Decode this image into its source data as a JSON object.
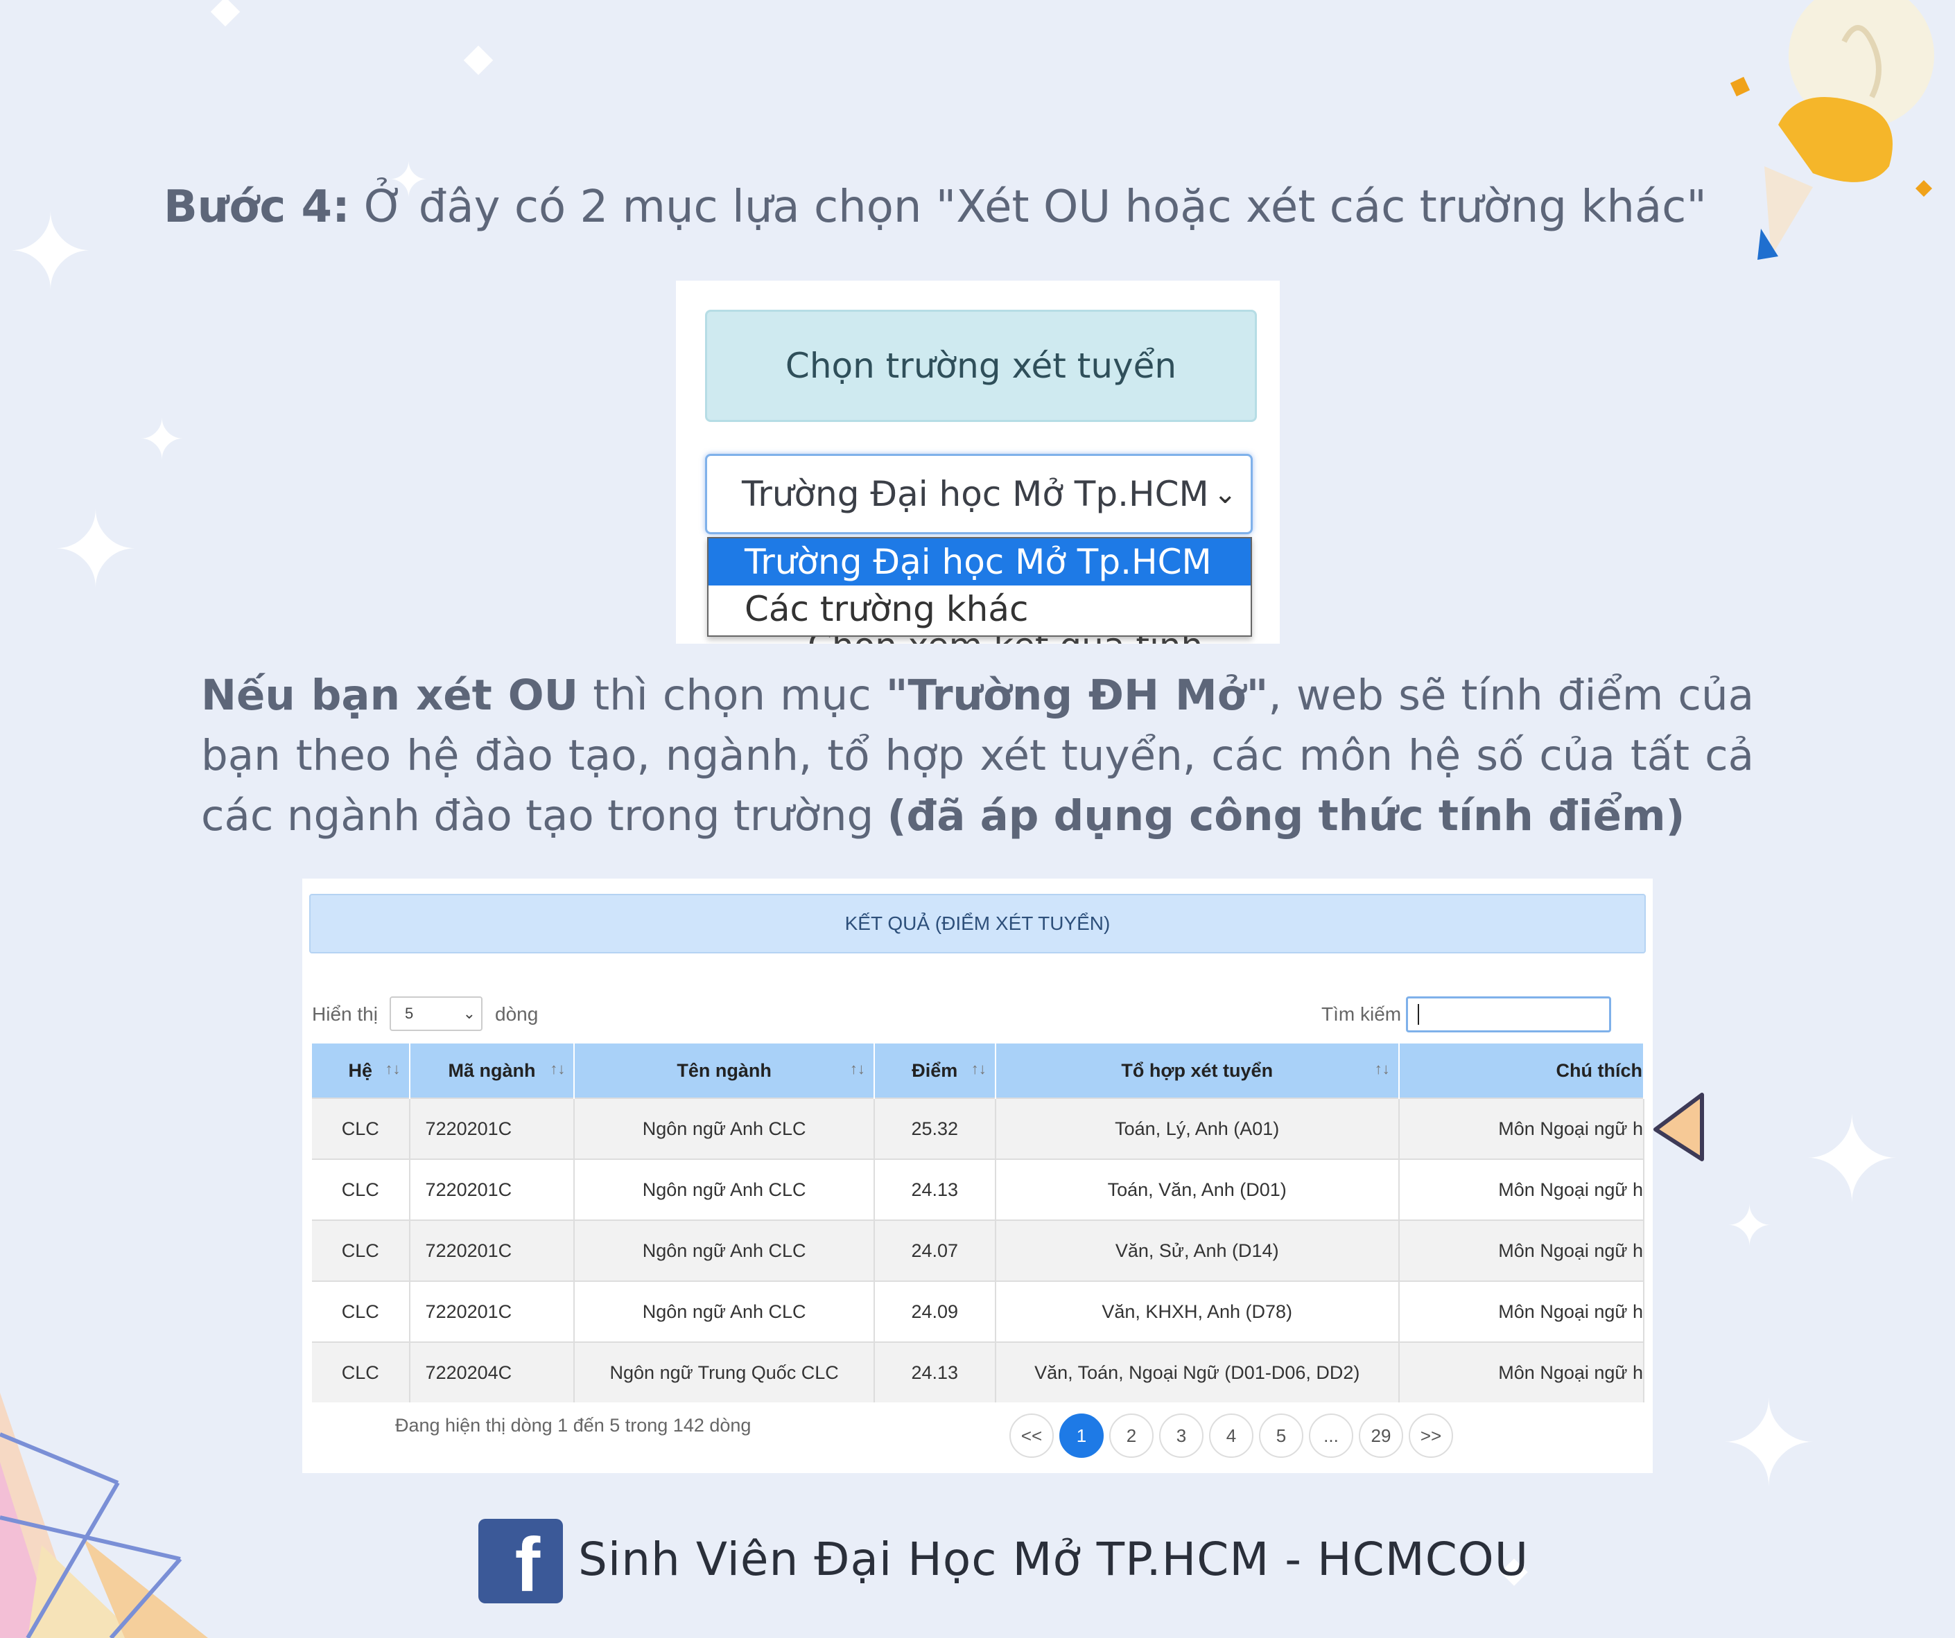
{
  "heading": {
    "step_label": "Bước 4:",
    "step_text": " Ở đây có 2 mục lựa chọn \"Xét OU hoặc xét các trường khác\""
  },
  "selector_shot": {
    "choose_button": "Chọn trường xét tuyển",
    "selected_value": "Trường Đại học Mở Tp.HCM",
    "options": [
      "Trường Đại học Mở Tp.HCM",
      "Các trường khác"
    ],
    "partial_button": "Chọn xem kết quả tính"
  },
  "paragraph": {
    "p1_bold": "Nếu bạn xét OU",
    "p2": " thì chọn mục ",
    "p3_bold": "\"Trường ĐH Mở\"",
    "p4": ", web sẽ tính điểm của bạn theo hệ đào tạo, ngành, tổ hợp xét tuyển, các môn hệ số của tất cả các ngành đào tạo trong trường ",
    "p5_bold": "(đã áp dụng công thức tính điểm)"
  },
  "result_shot": {
    "header": "KẾT QUẢ (ĐIỂM XÉT TUYỂN)",
    "show_label": "Hiển thị",
    "page_size": "5",
    "rows_label": "dòng",
    "search_label": "Tìm kiếm",
    "search_value": "",
    "columns": [
      "Hệ",
      "Mã ngành",
      "Tên ngành",
      "Điểm",
      "Tổ hợp xét tuyển",
      "Chú thích"
    ],
    "rows": [
      {
        "he": "CLC",
        "ma": "7220201C",
        "ten": "Ngôn ngữ Anh CLC",
        "diem": "25.32",
        "tohop": "Toán, Lý, Anh (A01)",
        "chuthich": "Môn Ngoại ngữ h"
      },
      {
        "he": "CLC",
        "ma": "7220201C",
        "ten": "Ngôn ngữ Anh CLC",
        "diem": "24.13",
        "tohop": "Toán, Văn, Anh (D01)",
        "chuthich": "Môn Ngoại ngữ h"
      },
      {
        "he": "CLC",
        "ma": "7220201C",
        "ten": "Ngôn ngữ Anh CLC",
        "diem": "24.07",
        "tohop": "Văn, Sử, Anh (D14)",
        "chuthich": "Môn Ngoại ngữ h"
      },
      {
        "he": "CLC",
        "ma": "7220201C",
        "ten": "Ngôn ngữ Anh CLC",
        "diem": "24.09",
        "tohop": "Văn, KHXH, Anh (D78)",
        "chuthich": "Môn Ngoại ngữ h"
      },
      {
        "he": "CLC",
        "ma": "7220204C",
        "ten": "Ngôn ngữ Trung Quốc CLC",
        "diem": "24.13",
        "tohop": "Văn, Toán, Ngoại Ngữ (D01-D06, DD2)",
        "chuthich": "Môn Ngoại ngữ h"
      }
    ],
    "info": "Đang hiện thị dòng 1 đến 5 trong 142 dòng",
    "pager": [
      "<<",
      "1",
      "2",
      "3",
      "4",
      "5",
      "...",
      "29",
      ">>"
    ],
    "active_page": "1"
  },
  "footer": {
    "icon": "facebook-icon",
    "text": "Sinh Viên Đại Học Mở TP.HCM - HCMCOU"
  },
  "colors": {
    "background": "#e9eef8",
    "accent_blue": "#1e7ae6",
    "facebook": "#3b5998"
  }
}
